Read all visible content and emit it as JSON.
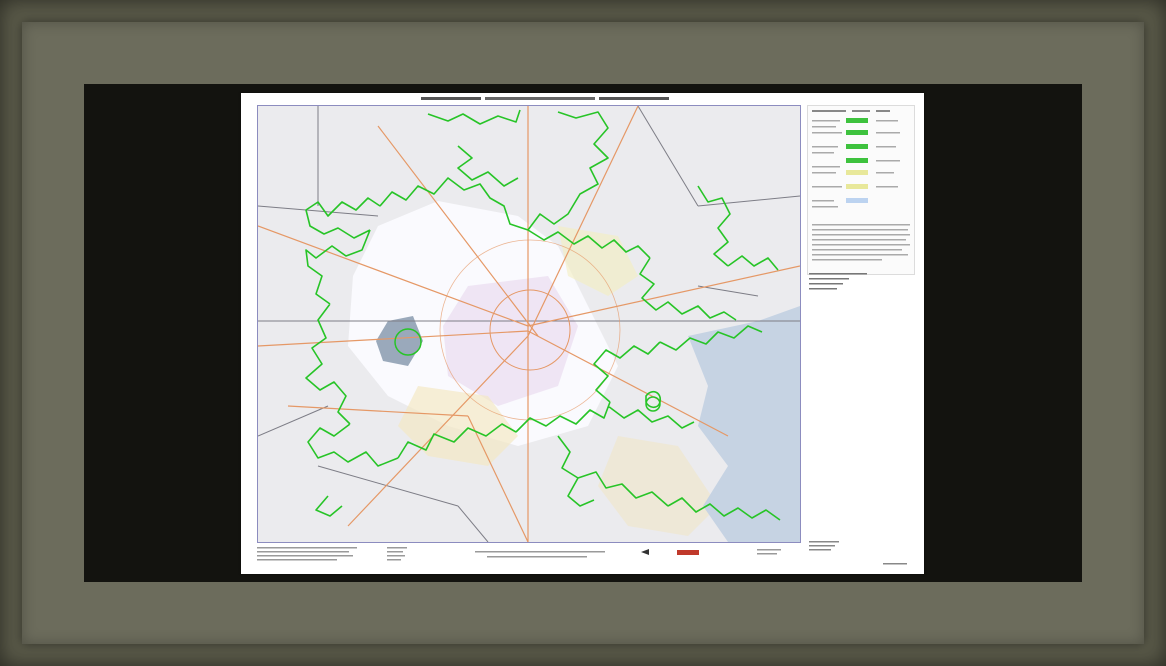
{
  "colors": {
    "outer_frame": "#5b5b4a",
    "mat": "#6c6c5c",
    "backdrop": "#13130f",
    "sheet": "#ffffff",
    "boundary_line": "#22cc22",
    "highway": "#e88a5a",
    "water": "#c6d3e3",
    "county_line": "#777777",
    "border": "#8c8cbf"
  },
  "map": {
    "overlays": [
      "nonattainment-boundary",
      "highways",
      "county-lines",
      "urban-areas",
      "bay-water"
    ],
    "legend_swatches": [
      "#3ec23e",
      "#3ec23e",
      "#3ec23e",
      "#3ec23e",
      "#e8e89a",
      "#e8e89a",
      "#bcd3f0"
    ]
  }
}
